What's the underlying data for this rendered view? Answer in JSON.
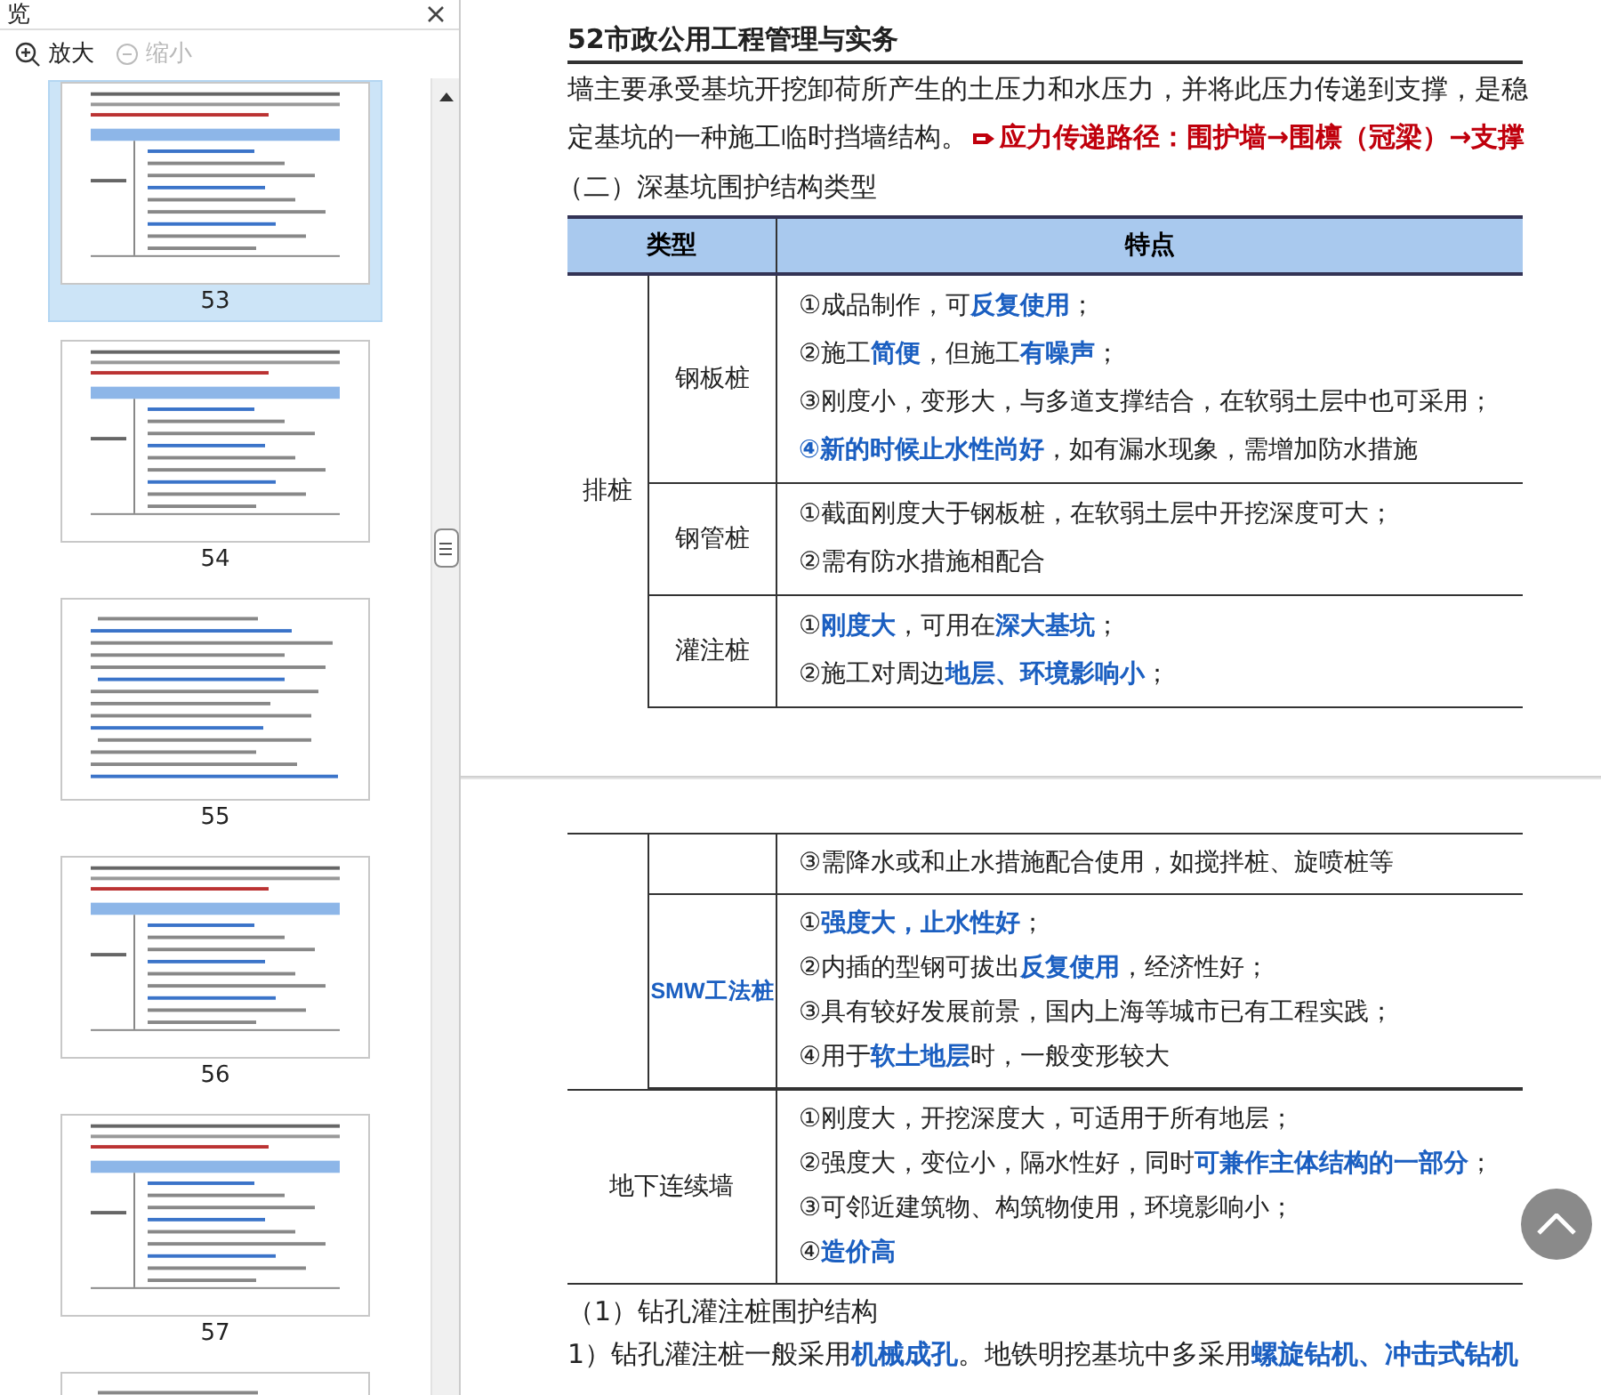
{
  "panel": {
    "title": "览",
    "zoom_in": "放大",
    "zoom_out": "缩小",
    "zoom_out_disabled": true,
    "thumbnails": [
      {
        "label": "53",
        "selected": true,
        "kind": "table"
      },
      {
        "label": "54",
        "selected": false,
        "kind": "table"
      },
      {
        "label": "55",
        "selected": false,
        "kind": "text"
      },
      {
        "label": "56",
        "selected": false,
        "kind": "table"
      },
      {
        "label": "57",
        "selected": false,
        "kind": "table"
      },
      {
        "selected": false,
        "kind": "text"
      }
    ]
  },
  "page_top": {
    "header": "52市政公用工程管理与实务",
    "paragraph_lines": [
      "墙主要承受基坑开挖卸荷所产生的土压力和水压力，并将此压力传递到支撑，是稳",
      "定基坑的一种施工临时挡墙结构。"
    ],
    "stress_path": "应力传递路径：围护墙→围檩（冠梁）→支撑",
    "heading": "（二）深基坑围护结构类型",
    "table": {
      "columns": [
        "类型",
        "特点"
      ],
      "groups": [
        {
          "kind": "nested",
          "type": "排桩",
          "rows": [
            {
              "name": "钢板桩",
              "lines": [
                [
                  {
                    "text": "①成品制作，可"
                  },
                  {
                    "text": "反复使用",
                    "highlight": true
                  },
                  {
                    "text": "；"
                  }
                ],
                [
                  {
                    "text": "②施工"
                  },
                  {
                    "text": "简便",
                    "highlight": true
                  },
                  {
                    "text": "，但施工"
                  },
                  {
                    "text": "有噪声",
                    "highlight": true
                  },
                  {
                    "text": "；"
                  }
                ],
                [
                  {
                    "text": "③刚度小，变形大，与多道支撑结合，在软弱土层中也可采用；"
                  }
                ],
                [
                  {
                    "text": "④新的时候止水性尚好",
                    "highlight": true
                  },
                  {
                    "text": "，如有漏水现象，需增加防水措施"
                  }
                ]
              ]
            },
            {
              "name": "钢管桩",
              "lines": [
                [
                  {
                    "text": "①截面刚度大于钢板桩，在软弱土层中开挖深度可大；"
                  }
                ],
                [
                  {
                    "text": "②需有防水措施相配合"
                  }
                ]
              ]
            },
            {
              "name": "灌注桩",
              "lines": [
                [
                  {
                    "text": "①"
                  },
                  {
                    "text": "刚度大",
                    "highlight": true
                  },
                  {
                    "text": "，可用在"
                  },
                  {
                    "text": "深大基坑",
                    "highlight": true
                  },
                  {
                    "text": "；"
                  }
                ],
                [
                  {
                    "text": "②施工对周边"
                  },
                  {
                    "text": "地层、环境影响小",
                    "highlight": true
                  },
                  {
                    "text": "；"
                  }
                ]
              ]
            }
          ]
        }
      ]
    }
  },
  "page_bottom": {
    "table": {
      "groups": [
        {
          "kind": "nested",
          "rows": [
            {
              "lines": [
                [
                  {
                    "text": "③需降水或和止水措施配合使用，如搅拌桩、旋喷桩等"
                  }
                ]
              ]
            },
            {
              "name": "SMW工法桩",
              "name_highlight": true,
              "lines": [
                [
                  {
                    "text": "①"
                  },
                  {
                    "text": "强度大，止水性好",
                    "highlight": true
                  },
                  {
                    "text": "；"
                  }
                ],
                [
                  {
                    "text": "②内插的型钢可拔出"
                  },
                  {
                    "text": "反复使用",
                    "highlight": true
                  },
                  {
                    "text": "，经济性好；"
                  }
                ],
                [
                  {
                    "text": "③具有较好发展前景，国内上海等城市已有工程实践；"
                  }
                ],
                [
                  {
                    "text": "④用于"
                  },
                  {
                    "text": "软土地层",
                    "highlight": true
                  },
                  {
                    "text": "时，一般变形较大"
                  }
                ]
              ]
            }
          ]
        },
        {
          "kind": "single",
          "type": "地下连续墙",
          "lines": [
            [
              {
                "text": "①刚度大，开挖深度大，可适用于所有地层；"
              }
            ],
            [
              {
                "text": "②强度大，变位小，隔水性好，同时"
              },
              {
                "text": "可兼作主体结构的一部分",
                "highlight": true
              },
              {
                "text": "；"
              }
            ],
            [
              {
                "text": "③可邻近建筑物、构筑物使用，环境影响小；"
              }
            ],
            [
              {
                "text": "④"
              },
              {
                "text": "造价高",
                "highlight": true
              }
            ]
          ]
        }
      ]
    },
    "heading": "（1）钻孔灌注桩围护结构",
    "paragraph": [
      {
        "text": "1）钻孔灌注桩一般采用"
      },
      {
        "text": "机械成孔",
        "highlight": true
      },
      {
        "text": "。地铁明挖基坑中多采用"
      },
      {
        "text": "螺旋钻机、冲击式钻机",
        "highlight": true
      }
    ]
  }
}
